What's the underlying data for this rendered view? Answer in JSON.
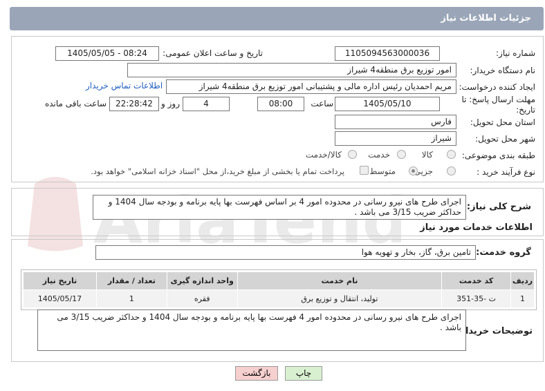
{
  "header": {
    "title": "جزئیات اطلاعات نیاز"
  },
  "fields": {
    "need_number_label": "شماره نیاز:",
    "need_number": "1105094563000036",
    "announce_label": "تاریخ و ساعت اعلان عمومی:",
    "announce_value": "1405/05/05 - 08:24",
    "buyer_label": "نام دستگاه خریدار:",
    "buyer_value": "امور توزیع برق منطقه4 شیراز",
    "creator_label": "ایجاد کننده درخواست:",
    "creator_value": "مریم احمدیان رئیس اداره مالی و پشتیبانی امور توزیع برق منطقه4 شیراز",
    "contact_link": "اطلاعات تماس خریدار",
    "deadline_label_1": "مهلت ارسال پاسخ: تا",
    "deadline_label_2": "تاریخ:",
    "deadline_date": "1405/05/10",
    "time_label": "ساعت",
    "deadline_time": "08:00",
    "days_value": "4",
    "days_label": "روز و",
    "remaining_time": "22:28:42",
    "remaining_label": "ساعت باقی مانده",
    "province_label": "استان محل تحویل:",
    "province_value": "فارس",
    "city_label": "شهر محل تحویل:",
    "city_value": "شیراز",
    "category_label": "طبقه بندی موضوعی:",
    "category_options": [
      "کالا",
      "خدمت",
      "کالا/خدمت"
    ],
    "process_label": "نوع فرآیند خرید :",
    "process_options": [
      "جزیی",
      "متوسط"
    ],
    "payment_note": "پرداخت تمام یا بخشی از مبلغ خرید،از محل \"اسناد خزانه اسلامی\" خواهد بود."
  },
  "description": {
    "label": "شرح کلی نیاز:",
    "text": "اجرای طرح های نیرو رسانی در محدوده امور 4 بر اساس فهرست بها پایه برنامه و بودجه سال 1404 و حداکثر ضریب 3/15 می باشد ."
  },
  "services": {
    "section_title": "اطلاعات خدمات مورد نیاز",
    "group_label": "گروه خدمت:",
    "group_value": "تامین برق، گاز، بخار و تهویه هوا",
    "columns": [
      "ردیف",
      "کد خدمت",
      "نام خدمت",
      "واحد اندازه گیری",
      "تعداد / مقدار",
      "تاریخ نیاز"
    ],
    "rows": [
      [
        "1",
        "ت -35-351",
        "تولید، انتقال و توزیع برق",
        "فقره",
        "1",
        "1405/05/17"
      ]
    ]
  },
  "buyer_notes": {
    "label": "توضیحات خریدار:",
    "text": "اجرای طرح های نیرو رسانی در محدوده امور 4 فهرست بها پایه برنامه و بودجه سال 1404 و حداکثر ضریب 3/15 می باشد ."
  },
  "buttons": {
    "print": "چاپ",
    "back": "بازگشت"
  },
  "watermark": {
    "text": "AriaTender.net"
  }
}
